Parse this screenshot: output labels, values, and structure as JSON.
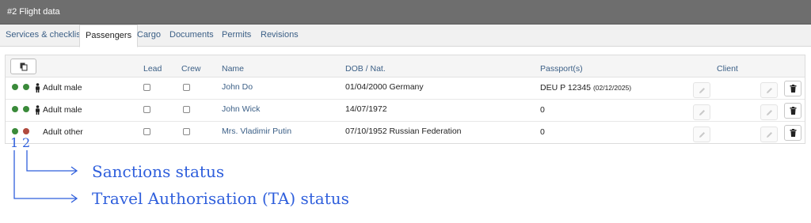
{
  "window": {
    "title": "#2 Flight data"
  },
  "tabs": [
    {
      "label": "Services & checklist",
      "active": false
    },
    {
      "label": "Passengers",
      "active": true
    },
    {
      "label": "Cargo",
      "active": false
    },
    {
      "label": "Documents",
      "active": false
    },
    {
      "label": "Permits",
      "active": false
    },
    {
      "label": "Revisions",
      "active": false
    }
  ],
  "table": {
    "headers": {
      "lead": "Lead",
      "crew": "Crew",
      "name": "Name",
      "dob": "DOB / Nat.",
      "passport": "Passport(s)",
      "client": "Client"
    },
    "rows": [
      {
        "ta_status": "#3a8a3a",
        "sanctions_status": "#3a8a3a",
        "person_icon": "person-icon",
        "type": "Adult male",
        "lead": false,
        "crew": false,
        "name": "John Do",
        "dob_nat": "01/04/2000 Germany",
        "passport": "DEU P 12345",
        "passport_expiry": "(02/12/2025)"
      },
      {
        "ta_status": "#3a8a3a",
        "sanctions_status": "#3a8a3a",
        "person_icon": "person-icon",
        "type": "Adult male",
        "lead": false,
        "crew": false,
        "name": "John Wick",
        "dob_nat": "14/07/1972",
        "passport": "0",
        "passport_expiry": ""
      },
      {
        "ta_status": "#3a8a3a",
        "sanctions_status": "#b04a3e",
        "person_icon": "",
        "type": "Adult other",
        "lead": false,
        "crew": false,
        "name": "Mrs. Vladimir Putin",
        "dob_nat": "07/10/1952 Russian Federation",
        "passport": "0",
        "passport_expiry": ""
      }
    ]
  },
  "annotations": {
    "num1": "1",
    "num2": "2",
    "sanctions": "Sanctions status",
    "ta": "Travel Authorisation (TA) status",
    "color": "#2f5fdc"
  },
  "colors": {
    "link": "#3b5f86",
    "titlebar": "#6e6e6e",
    "status_ok": "#3a8a3a",
    "status_alert": "#b04a3e"
  }
}
